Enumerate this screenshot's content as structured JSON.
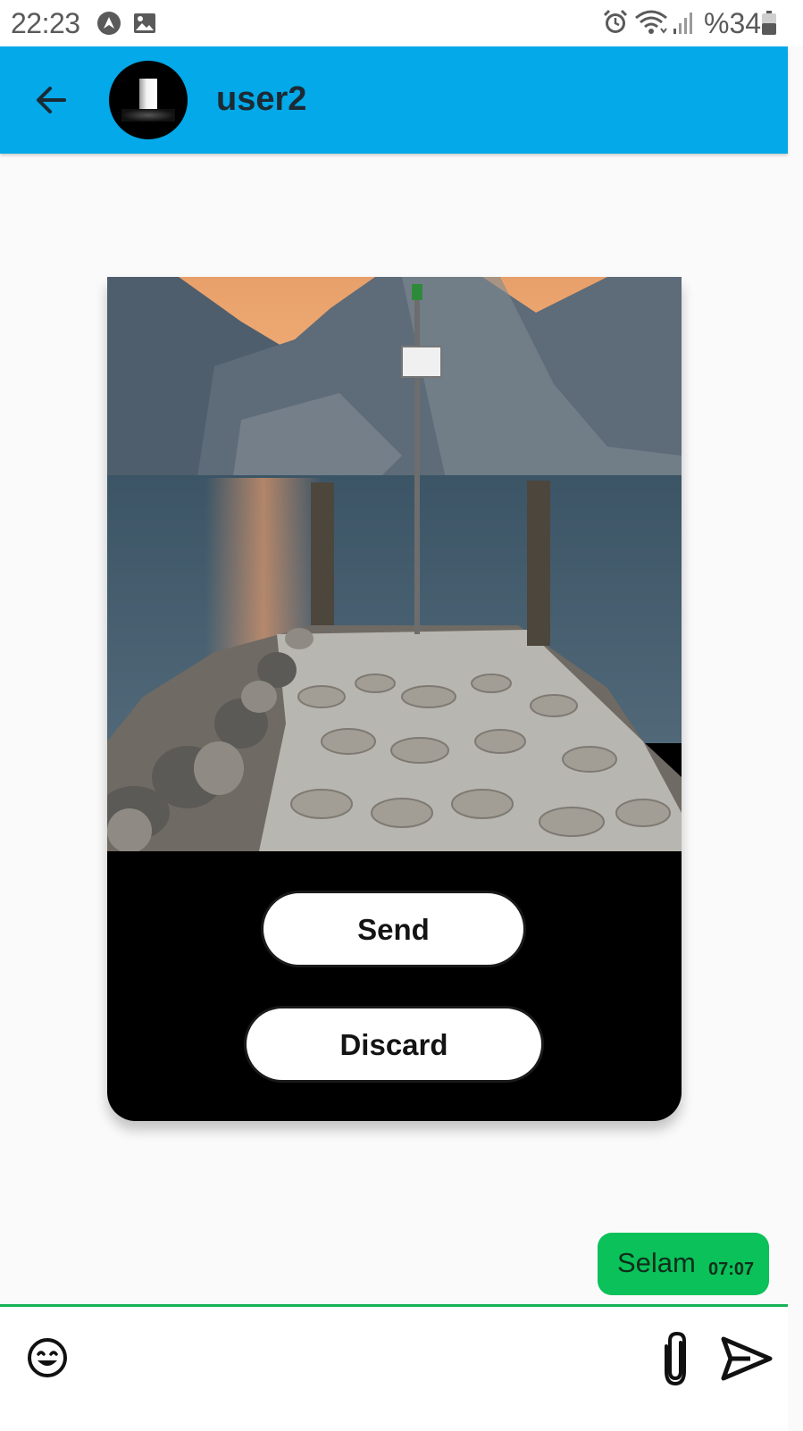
{
  "status_bar": {
    "time": "22:23",
    "battery": "%34",
    "icons": [
      "navigation-a-icon",
      "image-icon",
      "alarm-icon",
      "wifi-icon",
      "signal-icon",
      "battery-icon"
    ]
  },
  "chat_header": {
    "back_icon": "arrow-left-icon",
    "contact_name": "user2",
    "accent_color": "#03a9e8"
  },
  "image_preview": {
    "photo_description_icon": "image-photo",
    "send_label": "Send",
    "discard_label": "Discard"
  },
  "messages": [
    {
      "text": "Selam",
      "time": "07:07",
      "outgoing": true,
      "bubble_color": "#0bc15a"
    }
  ],
  "composer": {
    "placeholder": "",
    "emoji_icon": "emoji-icon",
    "attach_icon": "paperclip-icon",
    "send_icon": "send-icon",
    "border_color": "#16b356"
  }
}
